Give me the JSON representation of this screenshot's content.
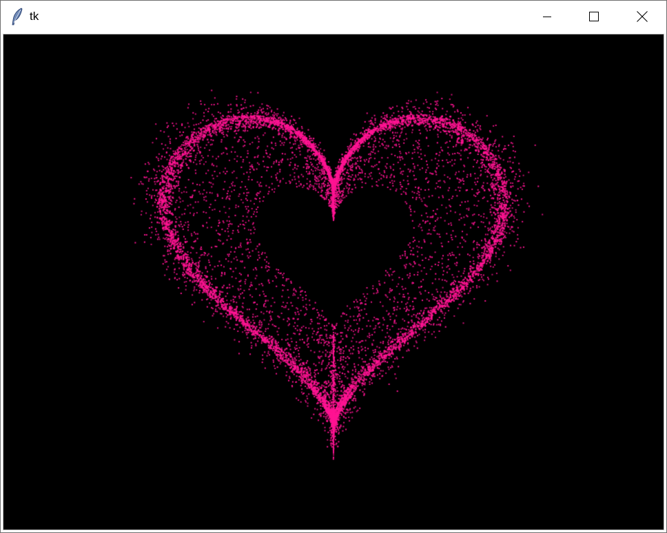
{
  "window": {
    "title": "tk",
    "icon": "feather-icon",
    "controls": {
      "minimize_icon": "minimize-icon",
      "maximize_icon": "maximize-icon",
      "close_icon": "close-icon"
    }
  },
  "canvas": {
    "background_color": "#000000",
    "particle_color": "#ff1493",
    "shape": "heart"
  }
}
